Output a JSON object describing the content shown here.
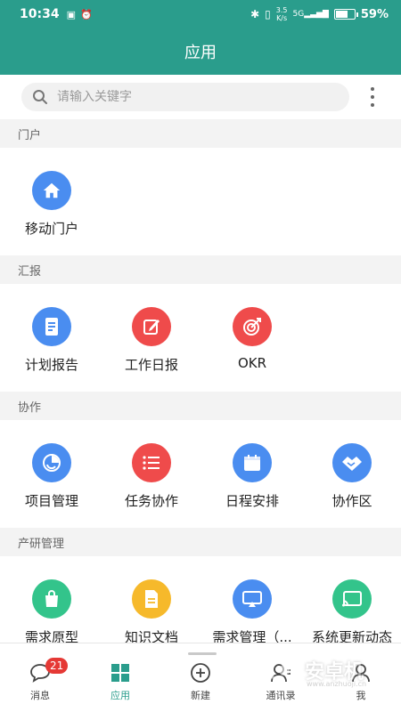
{
  "status_bar": {
    "time": "10:34",
    "speed": "3.5",
    "speed_unit": "K/s",
    "network": "5G",
    "battery_percent": "59%",
    "battery_level": 0.59
  },
  "app_bar": {
    "title": "应用"
  },
  "search": {
    "placeholder": "请输入关键字"
  },
  "sections": [
    {
      "title": "门户",
      "items": [
        {
          "label": "移动门户",
          "icon": "home-icon",
          "color": "#4a8df0"
        }
      ]
    },
    {
      "title": "汇报",
      "items": [
        {
          "label": "计划报告",
          "icon": "document-icon",
          "color": "#4a8df0"
        },
        {
          "label": "工作日报",
          "icon": "edit-icon",
          "color": "#ef4b4b"
        },
        {
          "label": "OKR",
          "icon": "target-icon",
          "color": "#ef4b4b"
        }
      ]
    },
    {
      "title": "协作",
      "items": [
        {
          "label": "项目管理",
          "icon": "project-icon",
          "color": "#4a8df0"
        },
        {
          "label": "任务协作",
          "icon": "list-icon",
          "color": "#ef4b4b"
        },
        {
          "label": "日程安排",
          "icon": "calendar-icon",
          "color": "#4a8df0"
        },
        {
          "label": "协作区",
          "icon": "handshake-icon",
          "color": "#4a8df0"
        }
      ]
    },
    {
      "title": "产研管理",
      "items": [
        {
          "label": "需求原型",
          "icon": "bag-icon",
          "color": "#33c48b"
        },
        {
          "label": "知识文档",
          "icon": "file-icon",
          "color": "#f6b92b"
        },
        {
          "label": "需求管理（...",
          "icon": "screen-icon",
          "color": "#4a8df0"
        },
        {
          "label": "系统更新动态",
          "icon": "cast-icon",
          "color": "#33c48b"
        }
      ]
    }
  ],
  "bottom_nav": [
    {
      "label": "消息",
      "badge": "21",
      "icon": "message-icon"
    },
    {
      "label": "应用",
      "icon": "grid-icon",
      "active": true
    },
    {
      "label": "新建",
      "icon": "plus-circle-icon"
    },
    {
      "label": "通讯录",
      "icon": "contacts-icon"
    },
    {
      "label": "我",
      "icon": "user-icon"
    }
  ],
  "watermark": {
    "text": "安卓机",
    "url": "www.anzhuoji.cn"
  },
  "colors": {
    "primary": "#2a9d8c",
    "blue": "#4a8df0",
    "red": "#ef4b4b",
    "green": "#33c48b",
    "yellow": "#f6b92b"
  }
}
